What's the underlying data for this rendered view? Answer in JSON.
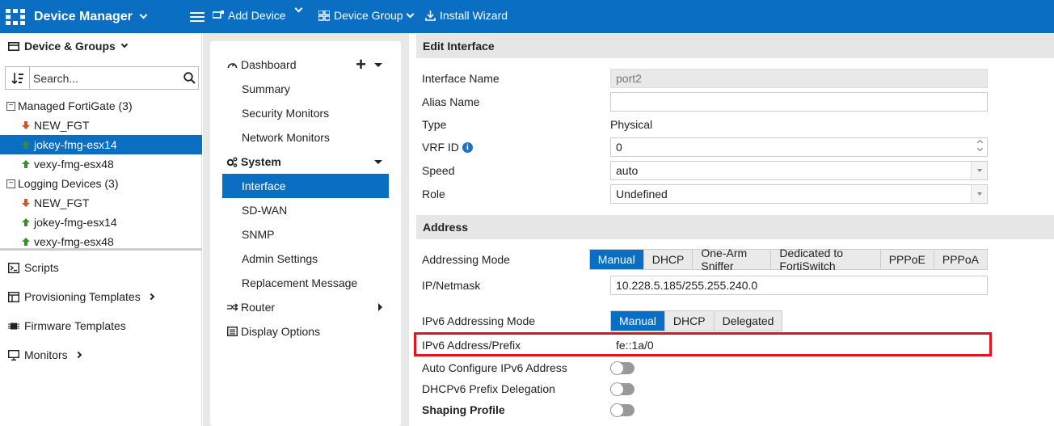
{
  "topbar": {
    "app_title": "Device Manager",
    "add_device": "Add Device",
    "device_group": "Device Group",
    "install_wizard": "Install Wizard",
    "bg_color": "#0a6fc2"
  },
  "left": {
    "header": "Device & Groups",
    "search_placeholder": "Search...",
    "tree": [
      {
        "type": "group",
        "label": "Managed FortiGate (3)"
      },
      {
        "type": "device",
        "label": "NEW_FGT",
        "status": "down"
      },
      {
        "type": "device",
        "label": "jokey-fmg-esx14",
        "status": "up",
        "selected": true
      },
      {
        "type": "device",
        "label": "vexy-fmg-esx48",
        "status": "up"
      },
      {
        "type": "group",
        "label": "Logging Devices (3)"
      },
      {
        "type": "device",
        "label": "NEW_FGT",
        "status": "down"
      },
      {
        "type": "device",
        "label": "jokey-fmg-esx14",
        "status": "up"
      },
      {
        "type": "device",
        "label": "vexy-fmg-esx48",
        "status": "up"
      }
    ],
    "nav": [
      {
        "label": "Scripts",
        "icon": "terminal-icon",
        "has_arrow": false
      },
      {
        "label": "Provisioning Templates",
        "icon": "template-icon",
        "has_arrow": true
      },
      {
        "label": "Firmware Templates",
        "icon": "chip-icon",
        "has_arrow": false
      },
      {
        "label": "Monitors",
        "icon": "monitor-icon",
        "has_arrow": true
      }
    ]
  },
  "middle": {
    "dashboard": "Dashboard",
    "summary": "Summary",
    "security_monitors": "Security Monitors",
    "network_monitors": "Network Monitors",
    "system": "System",
    "interface": "Interface",
    "sdwan": "SD-WAN",
    "snmp": "SNMP",
    "admin_settings": "Admin Settings",
    "replacement_message": "Replacement Message",
    "router": "Router",
    "display_options": "Display Options"
  },
  "form": {
    "edit_header": "Edit Interface",
    "interface_name_label": "Interface Name",
    "interface_name_value": "port2",
    "alias_label": "Alias Name",
    "alias_value": "",
    "type_label": "Type",
    "type_value": "Physical",
    "vrf_label": "VRF ID",
    "vrf_value": "0",
    "speed_label": "Speed",
    "speed_value": "auto",
    "role_label": "Role",
    "role_value": "Undefined",
    "address_header": "Address",
    "addressing_mode_label": "Addressing Mode",
    "addressing_modes": [
      "Manual",
      "DHCP",
      "One-Arm Sniffer",
      "Dedicated to FortiSwitch",
      "PPPoE",
      "PPPoA"
    ],
    "ip_label": "IP/Netmask",
    "ip_value": "10.228.5.185/255.255.240.0",
    "ipv6_mode_label": "IPv6 Addressing Mode",
    "ipv6_modes": [
      "Manual",
      "DHCP",
      "Delegated"
    ],
    "ipv6_prefix_label": "IPv6 Address/Prefix",
    "ipv6_prefix_value": "fe::1a/0",
    "auto_ipv6_label": "Auto Configure IPv6 Address",
    "dhcpv6_label": "DHCPv6 Prefix Delegation",
    "shaping_label": "Shaping Profile"
  },
  "colors": {
    "accent": "#0a6fc2",
    "highlight": "#e0161c",
    "status_up": "#3d8b2f",
    "status_down": "#d9531e"
  }
}
